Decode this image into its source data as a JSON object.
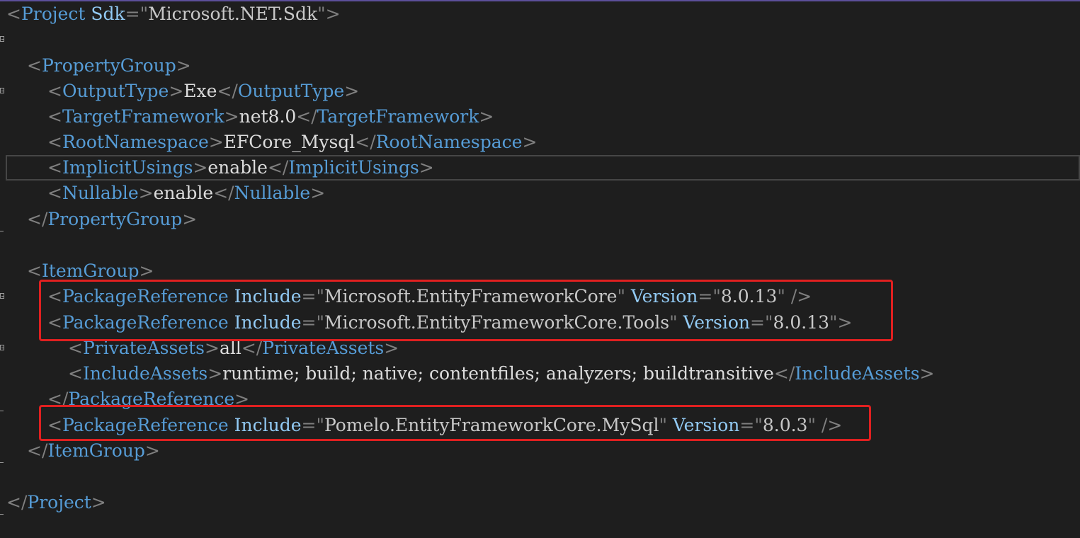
{
  "editor": {
    "lines": [
      {
        "open": "<",
        "tag": "Project",
        "attr": "Sdk",
        "eq": "=",
        "q1": "\"",
        "val": "Microsoft.NET.Sdk",
        "q2": "\"",
        "close": ">"
      },
      {
        "open": "<",
        "tag": "PropertyGroup",
        "close": ">"
      },
      {
        "open": "<",
        "tag": "OutputType",
        "close": ">",
        "text": "Exe",
        "open2": "</",
        "tag2": "OutputType",
        "close2": ">"
      },
      {
        "open": "<",
        "tag": "TargetFramework",
        "close": ">",
        "text": "net8.0",
        "open2": "</",
        "tag2": "TargetFramework",
        "close2": ">"
      },
      {
        "open": "<",
        "tag": "RootNamespace",
        "close": ">",
        "text": "EFCore_Mysql",
        "open2": "</",
        "tag2": "RootNamespace",
        "close2": ">"
      },
      {
        "open": "<",
        "tag": "ImplicitUsings",
        "close": ">",
        "text": "enable",
        "open2": "</",
        "tag2": "ImplicitUsings",
        "close2": ">"
      },
      {
        "open": "<",
        "tag": "Nullable",
        "close": ">",
        "text": "enable",
        "open2": "</",
        "tag2": "Nullable",
        "close2": ">"
      },
      {
        "open": "</",
        "tag": "PropertyGroup",
        "close": ">"
      },
      {
        "open": "<",
        "tag": "ItemGroup",
        "close": ">"
      },
      {
        "open": "<",
        "tag": "PackageReference",
        "attr1": "Include",
        "eq": "=",
        "q": "\"",
        "val1": "Microsoft.EntityFrameworkCore",
        "attr2": "Version",
        "val2": "8.0.13",
        "close": " />"
      },
      {
        "open": "<",
        "tag": "PackageReference",
        "attr1": "Include",
        "eq": "=",
        "q": "\"",
        "val1": "Microsoft.EntityFrameworkCore.Tools",
        "attr2": "Version",
        "val2": "8.0.13",
        "close": ">"
      },
      {
        "open": "<",
        "tag": "PrivateAssets",
        "close": ">",
        "text": "all",
        "open2": "</",
        "tag2": "PrivateAssets",
        "close2": ">"
      },
      {
        "open": "<",
        "tag": "IncludeAssets",
        "close": ">",
        "text": "runtime; build; native; contentfiles; analyzers; buildtransitive",
        "open2": "</",
        "tag2": "IncludeAssets",
        "close2": ">"
      },
      {
        "open": "</",
        "tag": "PackageReference",
        "close": ">"
      },
      {
        "open": "<",
        "tag": "PackageReference",
        "attr1": "Include",
        "eq": "=",
        "q": "\"",
        "val1": "Pomelo.EntityFrameworkCore.MySql",
        "attr2": "Version",
        "val2": "8.0.3",
        "close": " />"
      },
      {
        "open": "</",
        "tag": "ItemGroup",
        "close": ">"
      },
      {
        "open": "</",
        "tag": "Project",
        "close": ">"
      }
    ]
  },
  "colors": {
    "background": "#1e1e1e",
    "tag_bracket": "#808080",
    "tag_name": "#569cd6",
    "attribute_name": "#92caf4",
    "attribute_value": "#c8c8c8",
    "text": "#dcdcdc",
    "highlight_box": "#e02020"
  }
}
